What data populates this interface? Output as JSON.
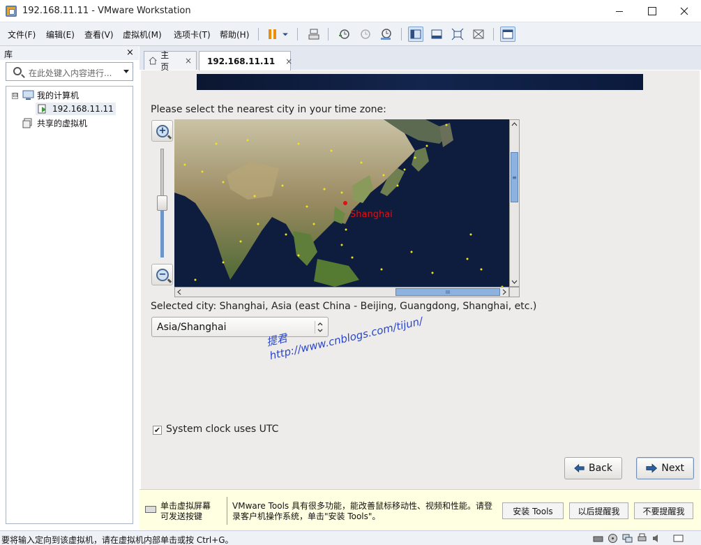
{
  "window": {
    "title": "192.168.11.11 - VMware Workstation"
  },
  "menu": [
    "文件(F)",
    "编辑(E)",
    "查看(V)",
    "虚拟机(M)",
    "选项卡(T)",
    "帮助(H)"
  ],
  "toolbar_icons": [
    "pause-icon",
    "send-keys-icon",
    "snapshot-icon",
    "revert-snapshot-icon",
    "snapshot-manager-icon",
    "show-library-icon",
    "thumbnail-icon",
    "fullscreen-icon",
    "unity-icon",
    "console-view-icon"
  ],
  "library": {
    "title": "库",
    "close": "×",
    "search_placeholder": "在此处键入内容进行...",
    "tree": {
      "my_computer": "我的计算机",
      "vm_name": "192.168.11.11",
      "shared": "共享的虚拟机",
      "expander": "⊟"
    }
  },
  "tabs": [
    {
      "label": "主页",
      "close": "×"
    },
    {
      "label": "192.168.11.11",
      "close": "×"
    }
  ],
  "installer": {
    "prompt": "Please select the nearest city in your time zone:",
    "map_city_label": "Shanghai",
    "selected_city": "Selected city: Shanghai, Asia (east China - Beijing, Guangdong, Shanghai, etc.)",
    "timezone_value": "Asia/Shanghai",
    "zoom_in": "+",
    "zoom_out": "−",
    "checkbox_mark": "✔",
    "utc_label": "System clock uses UTC",
    "utc_checked": true,
    "back": "Back",
    "next": "Next",
    "scroll_grip_v": "≡",
    "scroll_grip_h": "III"
  },
  "watermark": {
    "name": "提君",
    "url": "http://www.cnblogs.com/tijun/"
  },
  "tools_bar": {
    "hint": "单击虚拟屏幕\n可发送按键",
    "message": "VMware Tools 具有很多功能，能改善鼠标移动性、视频和性能。请登录客户机操作系统，单击\"安装 Tools\"。",
    "install": "安装 Tools",
    "remind_later": "以后提醒我",
    "never_remind": "不要提醒我"
  },
  "status": {
    "text": "要将输入定向到该虚拟机，请在虚拟机内部单击或按 Ctrl+G。"
  },
  "colors": {
    "accent": "#2f6fb8",
    "city_highlight": "#e01010",
    "watermark": "#2a46c8"
  }
}
